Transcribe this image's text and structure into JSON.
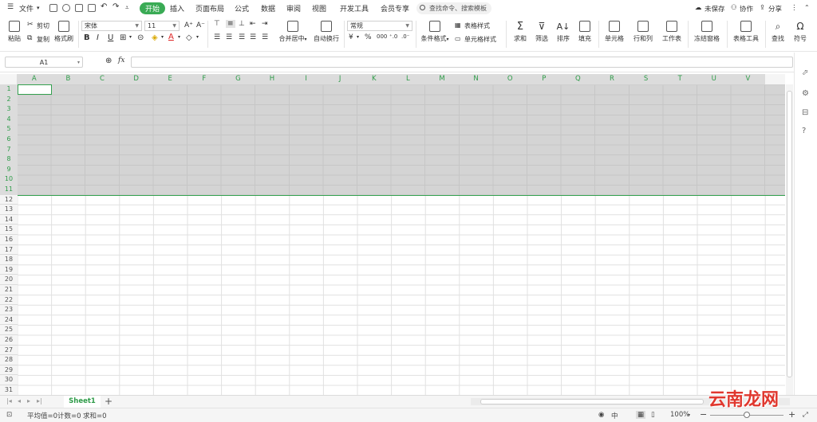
{
  "menubar": {
    "file": "文件",
    "tabs": [
      "开始",
      "插入",
      "页面布局",
      "公式",
      "数据",
      "审阅",
      "视图",
      "开发工具",
      "会员专享"
    ],
    "active_tab": "开始",
    "search_placeholder": "查找命令、搜索模板",
    "unsaved": "未保存",
    "collab": "协作",
    "share": "分享"
  },
  "ribbon": {
    "paste": "粘贴",
    "cut": "剪切",
    "copy": "复制",
    "format_painter": "格式刷",
    "font_name": "宋体",
    "font_size": "11",
    "bold": "B",
    "italic": "I",
    "underline": "U",
    "merge_center": "合并居中",
    "wrap_text": "自动换行",
    "number_format": "常规",
    "conditional_format": "条件格式",
    "table_style": "表格样式",
    "cell_style": "单元格样式",
    "sum": "求和",
    "filter": "筛选",
    "sort": "排序",
    "fill": "填充",
    "cells": "单元格",
    "rows_cols": "行和列",
    "worksheet": "工作表",
    "freeze": "冻结窗格",
    "table_tools": "表格工具",
    "find": "查找",
    "symbol": "符号"
  },
  "formula_bar": {
    "name_box": "A1",
    "fx": "fx",
    "value": ""
  },
  "grid": {
    "columns": [
      "A",
      "B",
      "C",
      "D",
      "E",
      "F",
      "G",
      "H",
      "I",
      "J",
      "K",
      "L",
      "M",
      "N",
      "O",
      "P",
      "Q",
      "R",
      "S",
      "T",
      "U",
      "V"
    ],
    "rows": [
      "1",
      "2",
      "3",
      "4",
      "5",
      "6",
      "7",
      "8",
      "9",
      "10",
      "11",
      "12",
      "13",
      "14",
      "15",
      "16",
      "17",
      "18",
      "19",
      "20",
      "21",
      "22",
      "23",
      "24",
      "25",
      "26",
      "27",
      "28",
      "29",
      "30",
      "31"
    ]
  },
  "sheets": {
    "active": "Sheet1",
    "add": "+"
  },
  "status": {
    "average": "平均值=0",
    "count": "计数=0",
    "sum": "求和=0",
    "zoom": "100%"
  },
  "watermark": "云南龙网",
  "colors": {
    "accent": "#3aab55",
    "selection": "#d4d4d4"
  }
}
